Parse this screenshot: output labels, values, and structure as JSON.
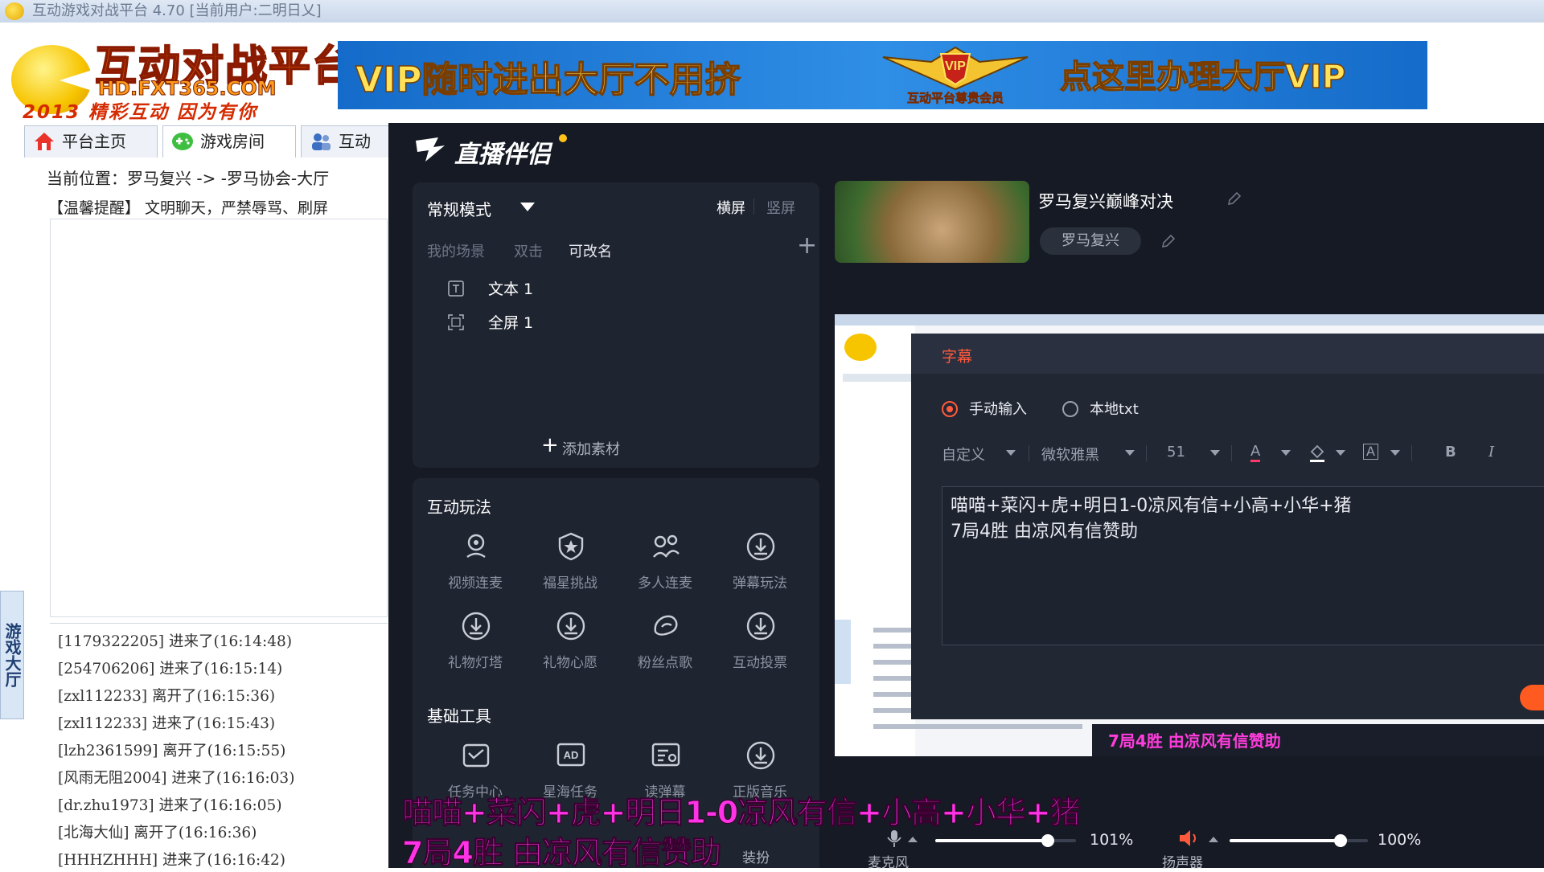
{
  "window": {
    "title": "互动游戏对战平台 4.70 [当前用户:二明日乂]"
  },
  "logo": {
    "title": "互动对战平台",
    "site": "HD.FXT365.COM",
    "slogan": "2013 精彩互动 因为有你"
  },
  "vip_banner": {
    "left_text": "VIP随时进出大厅不用挤",
    "right_text": "点这里办理大厅VIP",
    "badge_text": "互动平台尊贵会员",
    "badge_letters": "VIP"
  },
  "tabs": [
    {
      "label": "平台主页"
    },
    {
      "label": "游戏房间"
    },
    {
      "label": "互动"
    }
  ],
  "location": "当前位置：罗马复兴 -> -罗马协会-大厅",
  "notice": "【温馨提醒】 文明聊天，严禁辱骂、刷屏",
  "side_tab": "游戏大厅",
  "logs": [
    "[1179322205] 进来了(16:14:48)",
    "[254706206] 进来了(16:15:14)",
    "[zxl112233] 离开了(16:15:36)",
    "[zxl112233] 进来了(16:15:43)",
    "[lzh2361599] 离开了(16:15:55)",
    "[风雨无阻2004] 进来了(16:16:03)",
    "[dr.zhu1973] 进来了(16:16:05)",
    "[北海大仙] 离开了(16:16:36)",
    "[HHHZHHH] 进来了(16:16:42)"
  ],
  "app": {
    "name": "直播伴侣",
    "scene": {
      "mode": "常规模式",
      "orient_h": "横屏",
      "orient_v": "竖屏",
      "hint1": "我的场景",
      "hint2": "双击",
      "hint3": "可改名",
      "items": [
        {
          "label": "文本 1",
          "icon": "text-icon"
        },
        {
          "label": "全屏 1",
          "icon": "fullscreen-icon"
        }
      ],
      "add_material": "添加素材"
    },
    "interactive": {
      "title": "互动玩法",
      "tools": [
        {
          "label": "视频连麦",
          "icon": "video-link-icon"
        },
        {
          "label": "福星挑战",
          "icon": "star-shield-icon"
        },
        {
          "label": "多人连麦",
          "icon": "multi-link-icon"
        },
        {
          "label": "弹幕玩法",
          "icon": "download-icon"
        },
        {
          "label": "礼物灯塔",
          "icon": "download-icon"
        },
        {
          "label": "礼物心愿",
          "icon": "download-icon"
        },
        {
          "label": "粉丝点歌",
          "icon": "music-link-icon"
        },
        {
          "label": "互动投票",
          "icon": "download-icon"
        }
      ]
    },
    "basic": {
      "title": "基础工具",
      "tools": [
        {
          "label": "任务中心",
          "icon": "task-icon"
        },
        {
          "label": "星海任务",
          "icon": "ad-icon"
        },
        {
          "label": "读弹幕",
          "icon": "read-danmaku-icon"
        },
        {
          "label": "正版音乐",
          "icon": "download-icon"
        }
      ],
      "partial_label": "装扮"
    },
    "live": {
      "title": "罗马复兴巅峰对决",
      "tag": "罗马复兴"
    },
    "subtitle_dialog": {
      "title": "字幕",
      "option_manual": "手动输入",
      "option_local": "本地txt",
      "preset": "自定义",
      "font": "微软雅黑",
      "size": "51",
      "bold": "B",
      "italic": "I",
      "font_color_letter": "A",
      "bg_letter": "A",
      "text": "喵喵+菜闪+虎+明日1-0凉风有信+小高+小华+猪\n7局4胜 由凉风有信赞助"
    },
    "preview_caption": "7局4胜 由凉风有信赞助",
    "overlay": {
      "line1": "喵喵+菜闪+虎+明日1-0凉风有信+小高+小华+猪",
      "line2": "7局4胜 由凉风有信赞助"
    },
    "audio": {
      "mic_label": "麦克风",
      "mic_percent": "101%",
      "mic_level": 0.8,
      "speaker_label": "扬声器",
      "speaker_percent": "100%",
      "speaker_level": 0.8
    }
  },
  "colors": {
    "accent": "#ff5a3c",
    "overlay_text": "#ff33e6",
    "banner_blue": "#2f8ee6"
  }
}
